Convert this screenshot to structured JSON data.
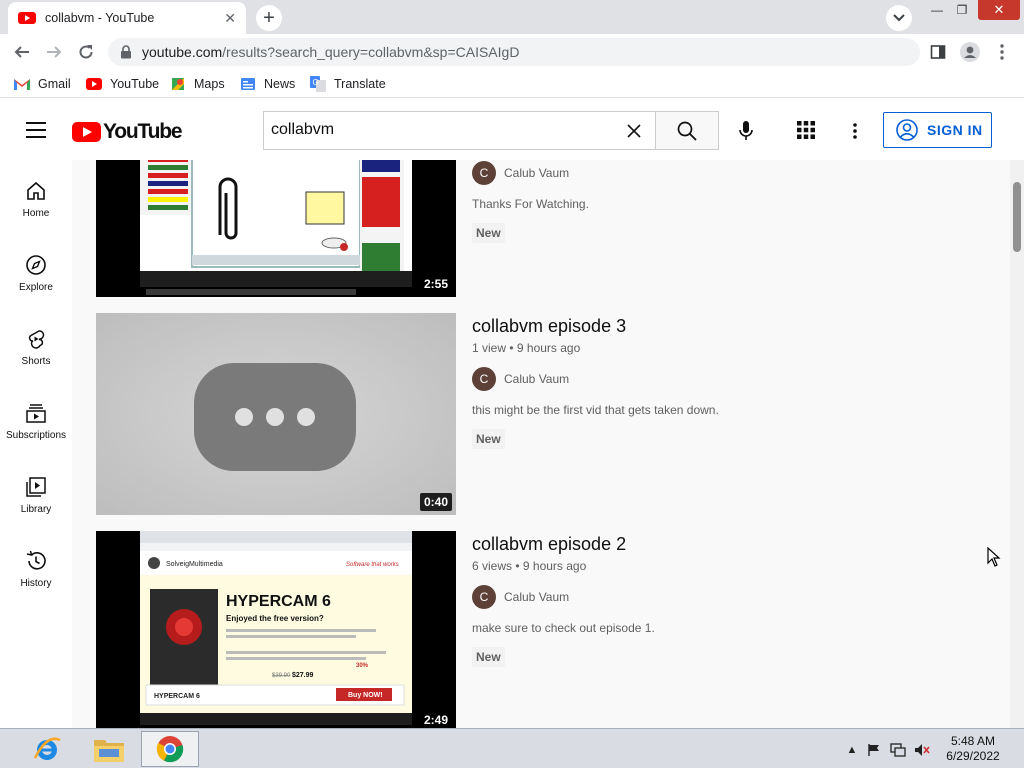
{
  "browser": {
    "tab_title": "collabvm - YouTube",
    "tab_close": "✕",
    "new_tab": "+",
    "url_host": "youtube.com",
    "url_path": "/results?search_query=collabvm&sp=CAISAIgD",
    "window_min": "—",
    "window_max": "❐",
    "window_close": "✕"
  },
  "bookmarks": [
    {
      "label": "Gmail",
      "icon": "gmail-icon"
    },
    {
      "label": "YouTube",
      "icon": "youtube-icon"
    },
    {
      "label": "Maps",
      "icon": "maps-icon"
    },
    {
      "label": "News",
      "icon": "news-icon"
    },
    {
      "label": "Translate",
      "icon": "translate-icon"
    }
  ],
  "masthead": {
    "logo_text": "YouTube",
    "search_value": "collabvm",
    "sign_in": "SIGN IN"
  },
  "sidebar": {
    "items": [
      {
        "label": "Home",
        "icon": "home-icon"
      },
      {
        "label": "Explore",
        "icon": "compass-icon"
      },
      {
        "label": "Shorts",
        "icon": "shorts-icon"
      },
      {
        "label": "Subscriptions",
        "icon": "subscriptions-icon"
      },
      {
        "label": "Library",
        "icon": "library-icon"
      },
      {
        "label": "History",
        "icon": "history-icon"
      }
    ]
  },
  "results": [
    {
      "title": "",
      "info": "",
      "channel": "Calub Vaum",
      "channel_initial": "C",
      "description": "Thanks For Watching.",
      "badge": "New",
      "duration": "2:55"
    },
    {
      "title": "collabvm episode 3",
      "info": "1 view • 9 hours ago",
      "channel": "Calub Vaum",
      "channel_initial": "C",
      "description": "this might be the first vid that gets taken down.",
      "badge": "New",
      "duration": "0:40"
    },
    {
      "title": "collabvm episode 2",
      "info": "6 views • 9 hours ago",
      "channel": "Calub Vaum",
      "channel_initial": "C",
      "description": "make sure to check out episode 1.",
      "badge": "New",
      "duration": "2:49"
    }
  ],
  "thumb3": {
    "brand": "SolveigMultimedia",
    "tagline": "Software that works",
    "product": "HYPERCAM",
    "version": "6",
    "headline": "Enjoyed the free version?",
    "button": "Buy NOW!",
    "price_old": "$39.90",
    "price_new": "$27.99",
    "discount": "30%"
  },
  "taskbar": {
    "time": "5:48 AM",
    "date": "6/29/2022"
  },
  "colors": {
    "youtube_red": "#ff0000",
    "link_blue": "#065fd4",
    "channel_avatar": "#5d4037"
  }
}
